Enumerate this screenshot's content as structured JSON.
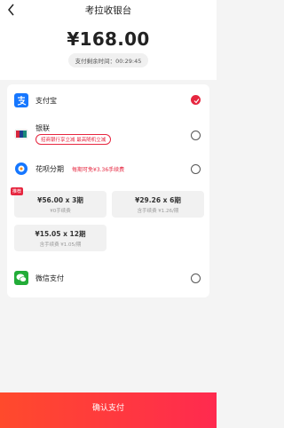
{
  "header": {
    "title": "考拉收银台"
  },
  "order": {
    "amount": "¥168.00",
    "countdown": "支付剩余时间：00:29:45"
  },
  "methods": {
    "alipay": {
      "label": "支付宝",
      "selected": true
    },
    "unionpay": {
      "label": "银联",
      "promo": "招商银行享立减 最高随机立减"
    },
    "huabei": {
      "label": "花呗分期",
      "promo": "每期可免¥3.36手续费",
      "badge": "推荐",
      "plans": [
        {
          "main": "¥56.00 x 3期",
          "sub": "¥0手续费"
        },
        {
          "main": "¥29.26 x 6期",
          "sub": "含手续费 ¥1.26/期"
        },
        {
          "main": "¥15.05 x 12期",
          "sub": "含手续费 ¥1.05/期"
        }
      ]
    },
    "wechat": {
      "label": "微信支付"
    }
  },
  "footer": {
    "confirm_label": "确认支付"
  },
  "colors": {
    "accent": "#e6263f",
    "alipay": "#1677ff",
    "wechat": "#22ac38"
  }
}
